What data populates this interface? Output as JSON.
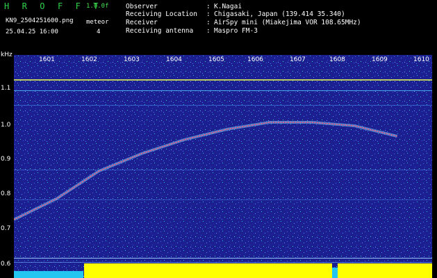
{
  "header": {
    "title": "H R O F F T",
    "version": "1.0.0f",
    "filename": "KN9_2504251600.png",
    "meteor_label": "meteor",
    "meteor_count": "4",
    "datetime": "25.04.25 16:00"
  },
  "info": [
    {
      "label": "Observer",
      "value": "K.Nagai"
    },
    {
      "label": "Receiving Location",
      "value": "Chigasaki, Japan (139.414 35.340)"
    },
    {
      "label": "Receiver",
      "value": "AirSpy mini (Miakejima VOR 108.65MHz)"
    },
    {
      "label": "Receiving antenna",
      "value": "Maspro FM-3"
    }
  ],
  "axis": {
    "y_unit": "kHz",
    "y_ticks": [
      "1.1",
      "1.0",
      "0.9",
      "0.8",
      "0.7",
      "0.6"
    ],
    "x_ticks": [
      "1601",
      "1602",
      "1603",
      "1604",
      "1605",
      "1606",
      "1607",
      "1608",
      "1609",
      "1610"
    ]
  },
  "colors": {
    "background": "#000000",
    "noise_base": "#1b1f8f",
    "trace": "#ff4d7a",
    "signal_bar": "#ffff00",
    "signal_low": "#22c6f0",
    "title_green": "#2fd24a"
  },
  "trace": {
    "x_ticks": [
      0,
      1,
      2,
      3,
      4,
      5,
      6,
      7,
      8,
      9
    ],
    "freq_khz": [
      0.72,
      0.78,
      0.86,
      0.91,
      0.95,
      0.98,
      1.0,
      1.0,
      0.99,
      0.96
    ]
  }
}
